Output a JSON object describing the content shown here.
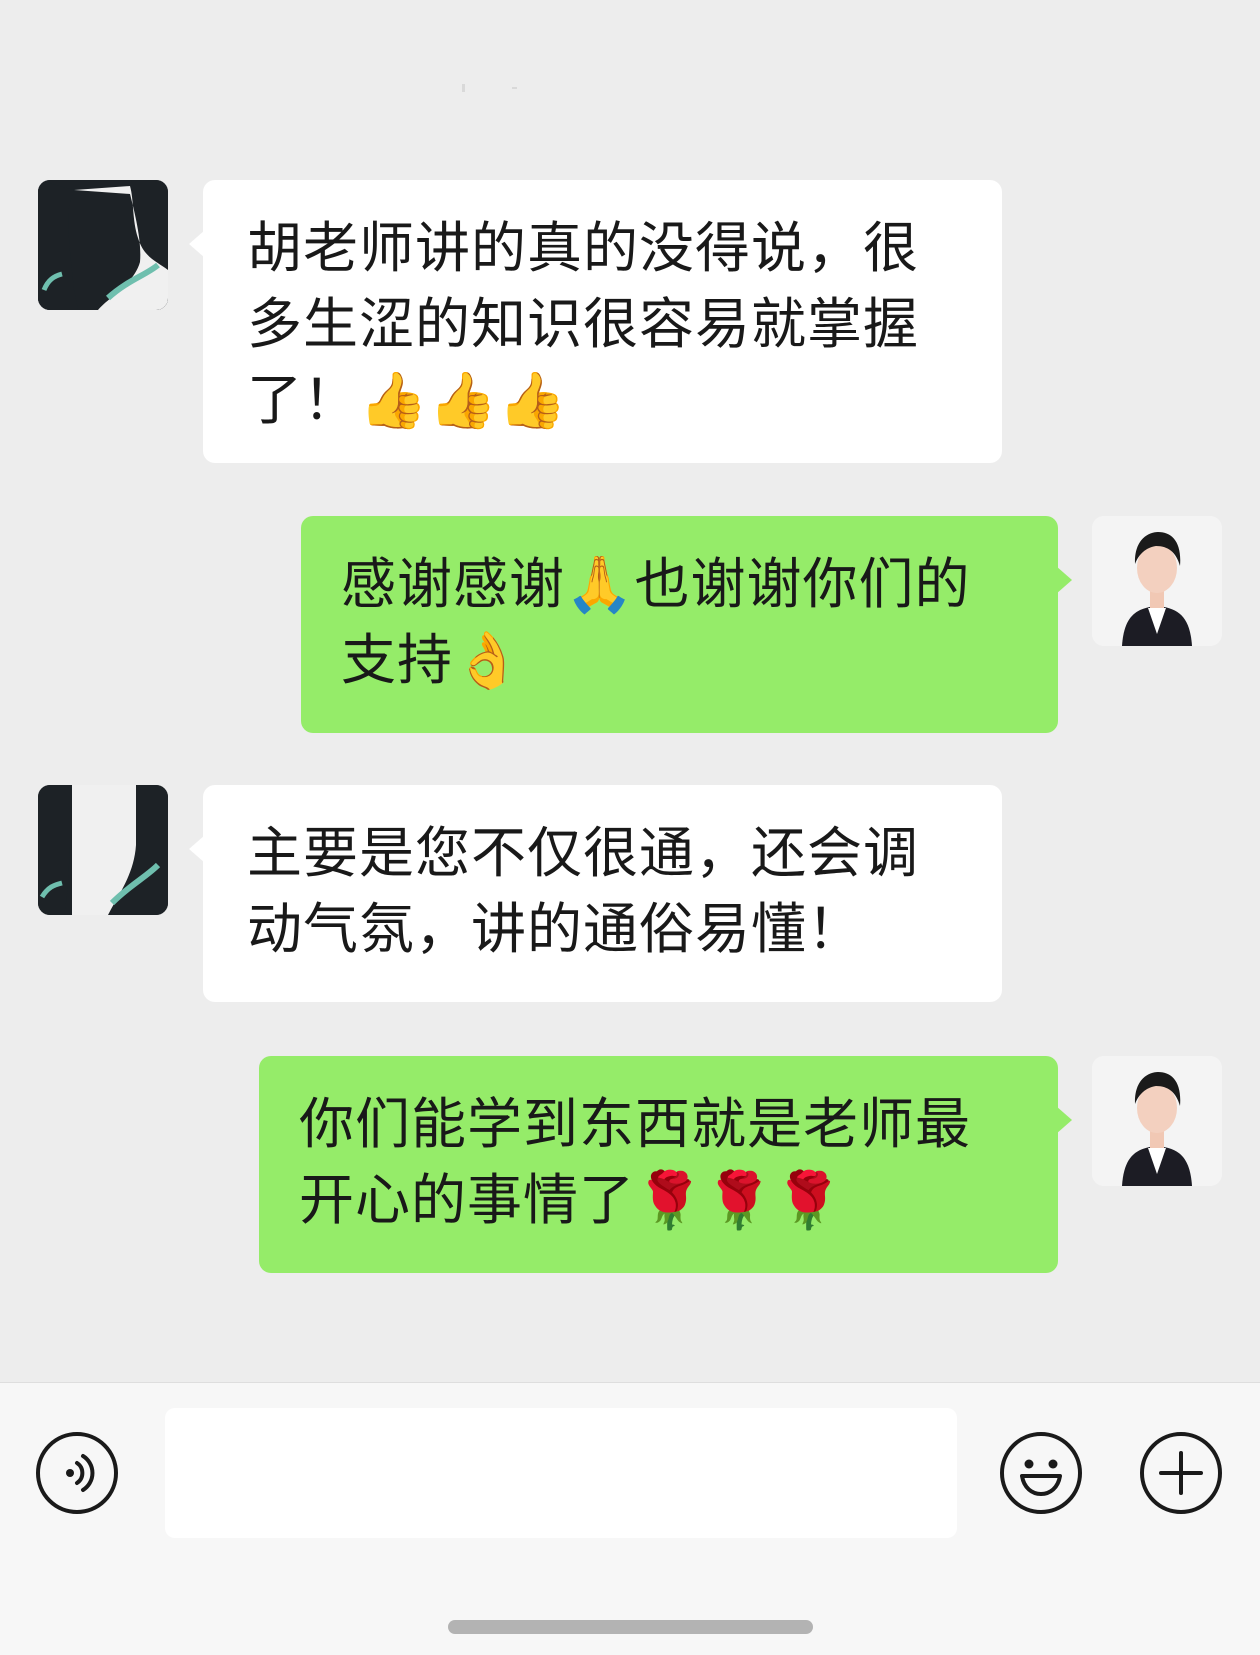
{
  "messages": [
    {
      "side": "left",
      "text": "胡老师讲的真的没得说，很多生涩的知识很容易就掌握了！👍👍👍"
    },
    {
      "side": "right",
      "text": "感谢感谢🙏也谢谢你们的支持👌"
    },
    {
      "side": "left",
      "text": "主要是您不仅很通，还会调动气氛，讲的通俗易懂！"
    },
    {
      "side": "right",
      "text": "你们能学到东西就是老师最开心的事情了🌹🌹🌹"
    }
  ],
  "input_bar": {
    "voice_icon": "voice-icon",
    "emoji_icon": "emoji-face-icon",
    "plus_icon": "plus-icon",
    "input_value": ""
  },
  "colors": {
    "background": "#ededed",
    "incoming_bubble": "#ffffff",
    "outgoing_bubble": "#95ec69",
    "text": "#191919"
  }
}
